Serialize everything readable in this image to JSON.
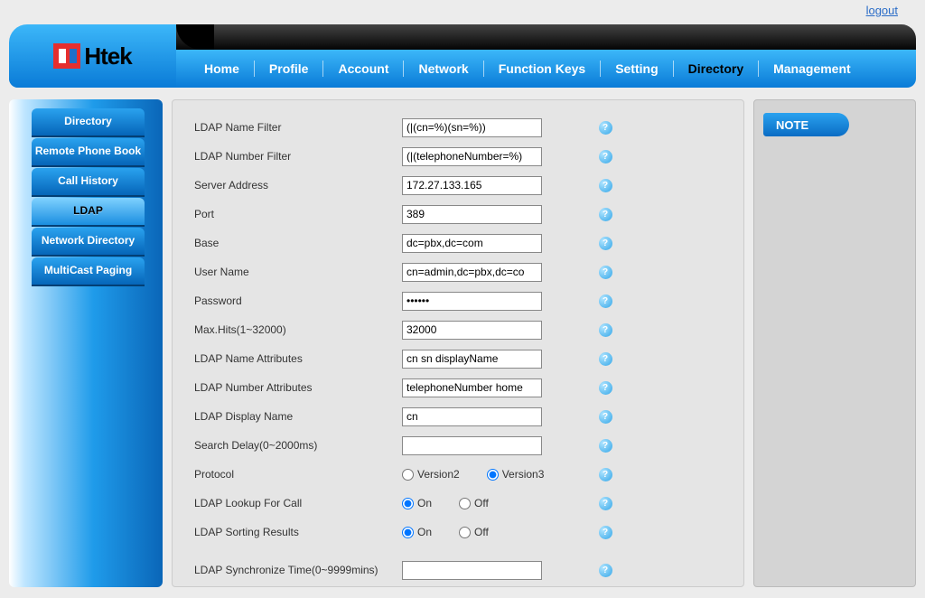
{
  "header": {
    "logout": "logout",
    "logo_text": "Htek",
    "nav": [
      {
        "label": "Home"
      },
      {
        "label": "Profile"
      },
      {
        "label": "Account"
      },
      {
        "label": "Network"
      },
      {
        "label": "Function Keys"
      },
      {
        "label": "Setting"
      },
      {
        "label": "Directory",
        "active": true
      },
      {
        "label": "Management"
      }
    ]
  },
  "sidebar": {
    "items": [
      {
        "label": "Directory"
      },
      {
        "label": "Remote Phone Book"
      },
      {
        "label": "Call History"
      },
      {
        "label": "LDAP",
        "active": true
      },
      {
        "label": "Network Directory"
      },
      {
        "label": "MultiCast Paging"
      }
    ]
  },
  "form": {
    "name_filter": {
      "label": "LDAP Name Filter",
      "value": "(|(cn=%)(sn=%))"
    },
    "number_filter": {
      "label": "LDAP Number Filter",
      "value": "(|(telephoneNumber=%)"
    },
    "server_address": {
      "label": "Server Address",
      "value": "172.27.133.165"
    },
    "port": {
      "label": "Port",
      "value": "389"
    },
    "base": {
      "label": "Base",
      "value": "dc=pbx,dc=com"
    },
    "user_name": {
      "label": "User Name",
      "value": "cn=admin,dc=pbx,dc=co"
    },
    "password": {
      "label": "Password",
      "value": "••••••"
    },
    "max_hits": {
      "label": "Max.Hits(1~32000)",
      "value": "32000"
    },
    "name_attrs": {
      "label": "LDAP Name Attributes",
      "value": "cn sn displayName"
    },
    "number_attrs": {
      "label": "LDAP Number Attributes",
      "value": "telephoneNumber home"
    },
    "display_name": {
      "label": "LDAP Display Name",
      "value": "cn"
    },
    "search_delay": {
      "label": "Search Delay(0~2000ms)",
      "value": ""
    },
    "protocol": {
      "label": "Protocol",
      "opt1": "Version2",
      "opt2": "Version3",
      "selected": "Version3"
    },
    "lookup_call": {
      "label": "LDAP Lookup For Call",
      "opt1": "On",
      "opt2": "Off",
      "selected": "On"
    },
    "sorting": {
      "label": "LDAP Sorting Results",
      "opt1": "On",
      "opt2": "Off",
      "selected": "On"
    },
    "sync_time": {
      "label": "LDAP Synchronize Time(0~9999mins)",
      "value": ""
    }
  },
  "note_panel": {
    "title": "NOTE"
  },
  "icons": {
    "help": "?"
  }
}
